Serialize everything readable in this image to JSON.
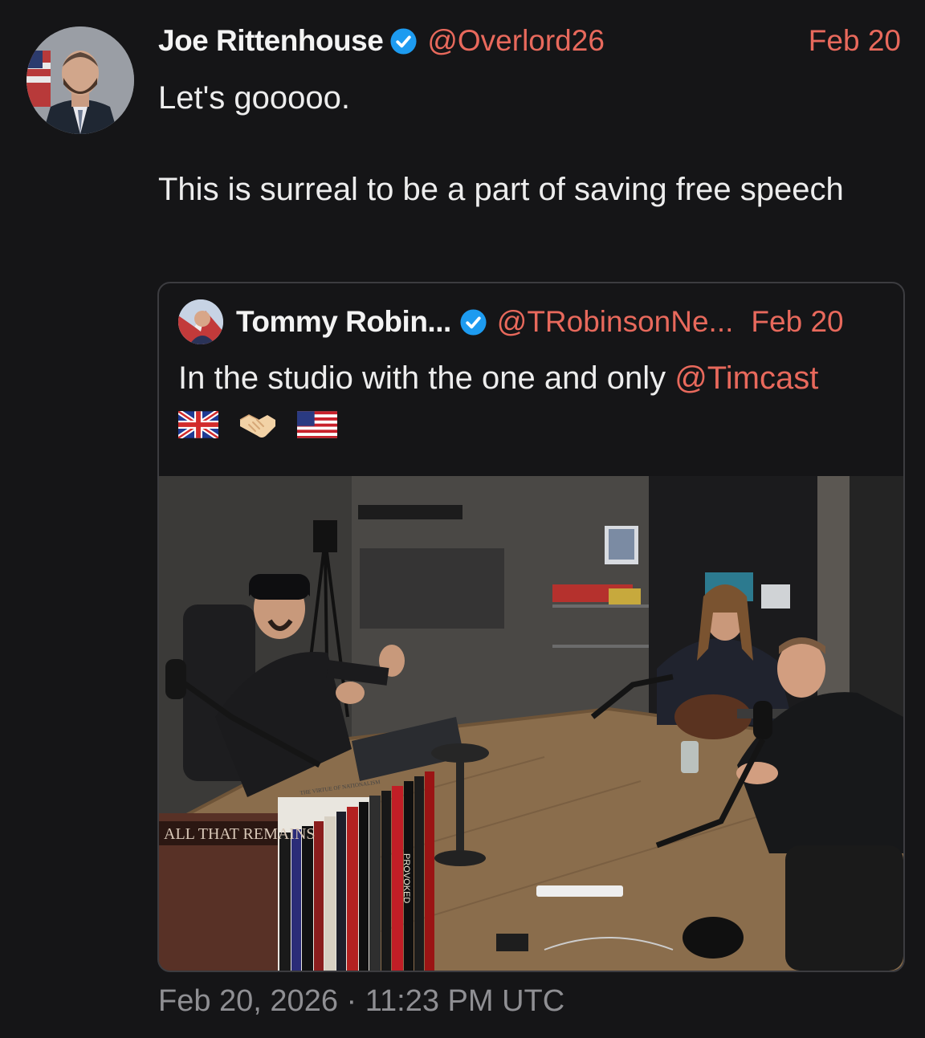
{
  "tweet": {
    "author_name": "Joe Rittenhouse",
    "handle": "@Overlord26",
    "date": "Feb 20",
    "text": "Let's gooooo.\n\nThis is surreal to be a part of saving free speech",
    "timestamp": "Feb 20, 2026 · 11:23 PM UTC"
  },
  "quoted": {
    "author_name": "Tommy Robin...",
    "handle": "@TRobinsonNe...",
    "date": "Feb 20",
    "text": "In the studio with the one and only ",
    "mention": "@Timcast",
    "emojis": [
      "uk-flag",
      "handshake",
      "us-flag"
    ]
  },
  "photo": {
    "book_titles": [
      "ALL THAT REMAINS",
      "PROVOKED",
      "THE VIRTUE OF NATIONALISM"
    ]
  },
  "colors": {
    "background": "#151517",
    "accent": "#e8695c",
    "verified": "#1d9bf0",
    "muted": "#8f8f93"
  },
  "icons": [
    "verified-badge-icon",
    "uk-flag-icon",
    "handshake-icon",
    "us-flag-icon"
  ]
}
